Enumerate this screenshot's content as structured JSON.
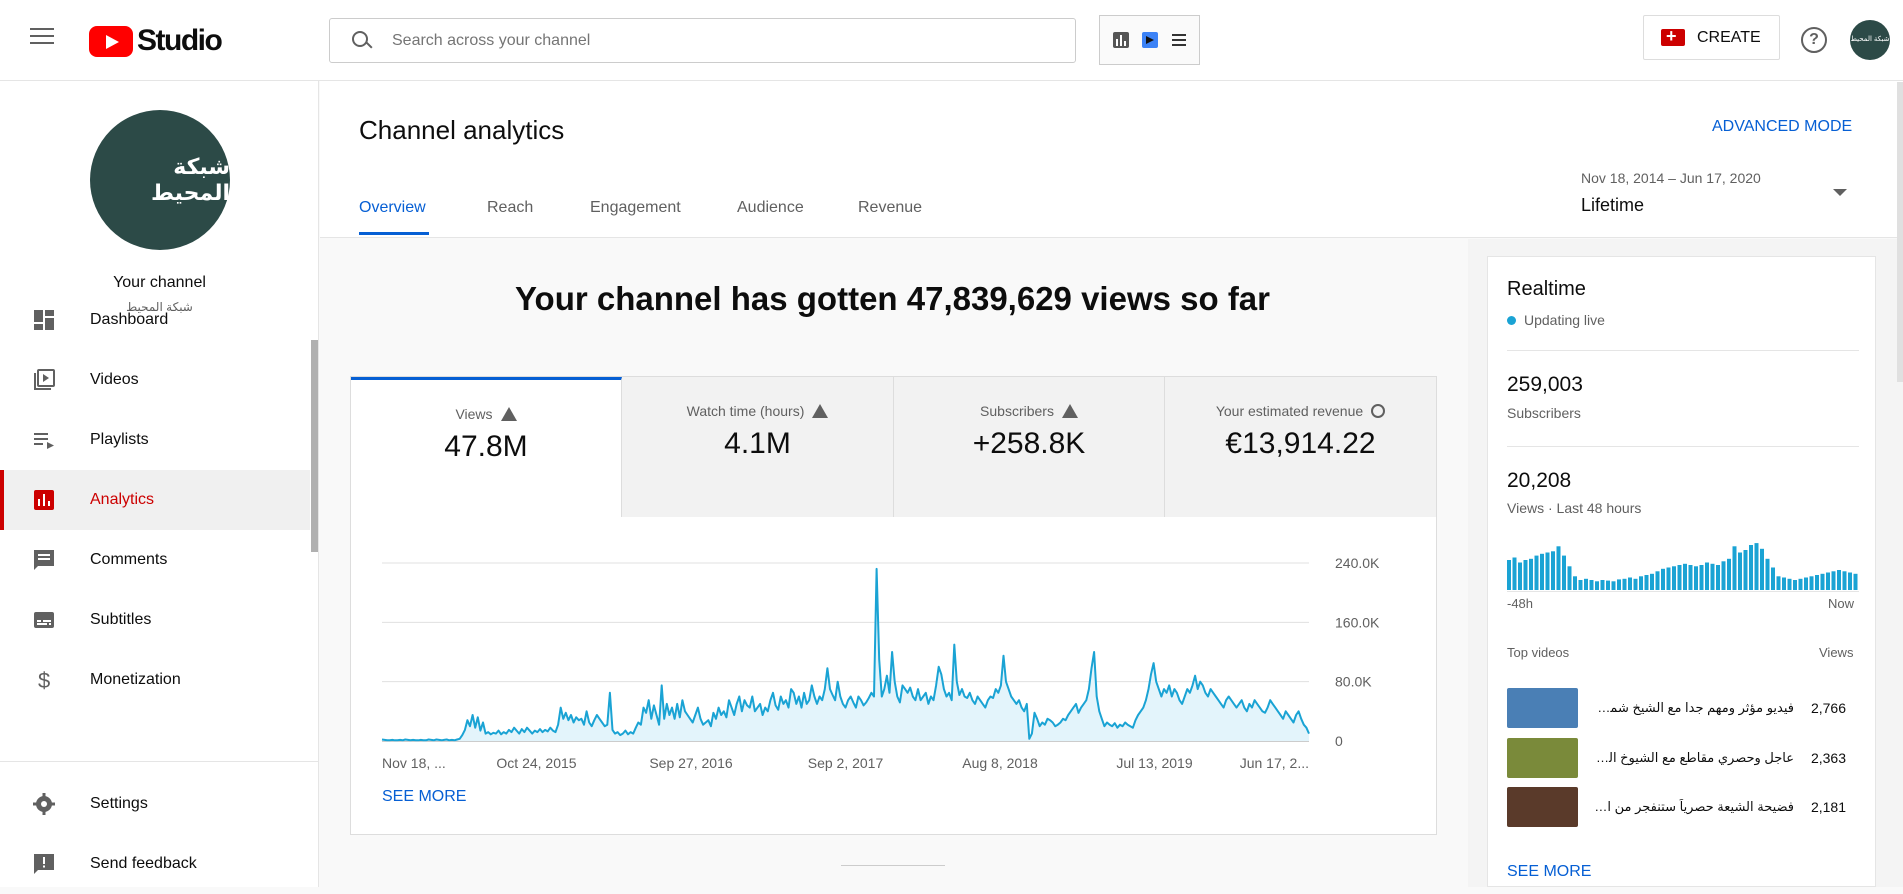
{
  "app": {
    "logo_text": "Studio",
    "create_label": "CREATE",
    "help_symbol": "?",
    "avatar_text": "شبكة المحيط"
  },
  "search": {
    "placeholder": "Search across your channel"
  },
  "sidebar": {
    "channel_avatar_text": "شبكة المحيط",
    "channel_title": "Your channel",
    "channel_name": "شبكة المحيط",
    "items": [
      {
        "label": "Dashboard",
        "icon": "dashboard-icon"
      },
      {
        "label": "Videos",
        "icon": "videos-icon"
      },
      {
        "label": "Playlists",
        "icon": "playlists-icon"
      },
      {
        "label": "Analytics",
        "icon": "analytics-icon",
        "active": true
      },
      {
        "label": "Comments",
        "icon": "comments-icon"
      },
      {
        "label": "Subtitles",
        "icon": "subtitles-icon"
      },
      {
        "label": "Monetization",
        "icon": "monetization-icon"
      },
      {
        "label": "Settings",
        "icon": "settings-icon"
      },
      {
        "label": "Send feedback",
        "icon": "feedback-icon"
      }
    ]
  },
  "header": {
    "title": "Channel analytics",
    "advanced_mode": "ADVANCED MODE",
    "tabs": [
      "Overview",
      "Reach",
      "Engagement",
      "Audience",
      "Revenue"
    ],
    "date_range": "Nov 18, 2014 – Jun 17, 2020",
    "date_label": "Lifetime"
  },
  "overview": {
    "headline": "Your channel has gotten 47,839,629 views so far",
    "metrics": [
      {
        "name": "Views",
        "value": "47.8M",
        "icon": "warning-icon"
      },
      {
        "name": "Watch time (hours)",
        "value": "4.1M",
        "icon": "warning-icon"
      },
      {
        "name": "Subscribers",
        "value": "+258.8K",
        "icon": "warning-icon"
      },
      {
        "name": "Your estimated revenue",
        "value": "€13,914.22",
        "icon": "clock-icon"
      }
    ],
    "see_more": "SEE MORE"
  },
  "chart_data": {
    "type": "area",
    "title": "",
    "xlabel": "",
    "ylabel": "",
    "x_tick_labels": [
      "Nov 18, ...",
      "Oct 24, 2015",
      "Sep 27, 2016",
      "Sep 2, 2017",
      "Aug 8, 2018",
      "Jul 13, 2019",
      "Jun 17, 2..."
    ],
    "y_tick_labels": [
      "240.0K",
      "160.0K",
      "80.0K",
      "0"
    ],
    "ylim": [
      0,
      240000
    ],
    "grid": true,
    "color": "#1aa3d4",
    "fill_color": "#e3f4fb",
    "series": [
      {
        "values": [
          2000,
          1500,
          1000,
          1000,
          1500,
          1000,
          1000,
          1500,
          1000,
          2000,
          1500,
          1000,
          1500,
          1000,
          1000,
          1500,
          1000,
          1000,
          2000,
          1500,
          1000,
          2000,
          1500,
          1000,
          1500,
          2000,
          1000,
          1500,
          1000,
          2000,
          3000,
          8000,
          15000,
          28000,
          20000,
          35000,
          18000,
          32000,
          14000,
          25000,
          10000,
          12000,
          9000,
          11000,
          10000,
          14000,
          9000,
          12000,
          10000,
          15000,
          12000,
          18000,
          14000,
          10000,
          16000,
          12000,
          18000,
          14000,
          10000,
          14000,
          12000,
          16000,
          12000,
          15000,
          13000,
          18000,
          14000,
          12000,
          22000,
          45000,
          30000,
          38000,
          28000,
          35000,
          25000,
          32000,
          28000,
          30000,
          22000,
          40000,
          25000,
          20000,
          28000,
          35000,
          30000,
          25000,
          20000,
          22000,
          65000,
          15000,
          10000,
          12000,
          8000,
          10000,
          14000,
          9000,
          12000,
          10000,
          18000,
          25000,
          22000,
          45000,
          38000,
          55000,
          30000,
          48000,
          35000,
          22000,
          75000,
          30000,
          50000,
          35000,
          45000,
          30000,
          50000,
          32000,
          55000,
          40000,
          35000,
          30000,
          25000,
          35000,
          45000,
          30000,
          22000,
          25000,
          28000,
          20000,
          38000,
          30000,
          45000,
          35000,
          40000,
          32000,
          55000,
          45000,
          35000,
          50000,
          60000,
          40000,
          55000,
          48000,
          45000,
          60000,
          40000,
          45000,
          50000,
          35000,
          45000,
          40000,
          55000,
          65000,
          48000,
          42000,
          60000,
          50000,
          55000,
          45000,
          70000,
          65000,
          50000,
          60000,
          45000,
          65000,
          50000,
          55000,
          75000,
          60000,
          50000,
          60000,
          55000,
          70000,
          98000,
          70000,
          62000,
          55000,
          80000,
          60000,
          50000,
          45000,
          55000,
          60000,
          52000,
          45000,
          60000,
          55000,
          48000,
          52000,
          58000,
          65000,
          60000,
          232000,
          110000,
          60000,
          70000,
          88000,
          65000,
          120000,
          80000,
          60000,
          52000,
          75000,
          70000,
          65000,
          72000,
          60000,
          55000,
          70000,
          55000,
          60000,
          65000,
          50000,
          60000,
          55000,
          75000,
          100000,
          90000,
          70000,
          60000,
          65000,
          55000,
          130000,
          80000,
          62000,
          70000,
          60000,
          58000,
          65000,
          55000,
          50000,
          60000,
          55000,
          50000,
          45000,
          55000,
          60000,
          58000,
          70000,
          65000,
          75000,
          115000,
          80000,
          70000,
          60000,
          55000,
          50000,
          55000,
          45000,
          40000,
          50000,
          3000,
          10000,
          38000,
          30000,
          20000,
          25000,
          22000,
          30000,
          28000,
          25000,
          20000,
          22000,
          25000,
          30000,
          28000,
          35000,
          40000,
          45000,
          50000,
          38000,
          45000,
          50000,
          55000,
          70000,
          98000,
          120000,
          60000,
          40000,
          30000,
          20000,
          25000,
          22000,
          20000,
          24000,
          18000,
          22000,
          20000,
          25000,
          22000,
          20000,
          18000,
          28000,
          35000,
          40000,
          45000,
          55000,
          70000,
          90000,
          105000,
          80000,
          70000,
          60000,
          70000,
          65000,
          75000,
          60000,
          70000,
          65000,
          55000,
          50000,
          60000,
          70000,
          65000,
          75000,
          88000,
          70000,
          80000,
          75000,
          65000,
          60000,
          70000,
          65000,
          60000,
          55000,
          50000,
          45000,
          55000,
          60000,
          55000,
          50000,
          45000,
          50000,
          55000,
          45000,
          40000,
          50000,
          45000,
          55000,
          50000,
          45000,
          40000,
          38000,
          45000,
          55000,
          50000,
          45000,
          40000,
          35000,
          30000,
          40000,
          35000,
          30000,
          25000,
          35000,
          40000,
          30000,
          22000,
          18000,
          10000
        ]
      }
    ]
  },
  "realtime": {
    "title": "Realtime",
    "live_text": "Updating live",
    "subscribers_value": "259,003",
    "subscribers_label": "Subscribers",
    "views_value": "20,208",
    "views_label": "Views · Last 48 hours",
    "axis_start": "-48h",
    "axis_end": "Now",
    "top_videos_label": "Top videos",
    "views_column": "Views",
    "bars": [
      48,
      52,
      44,
      48,
      50,
      55,
      58,
      60,
      62,
      70,
      55,
      38,
      22,
      16,
      18,
      16,
      14,
      16,
      15,
      14,
      17,
      18,
      20,
      18,
      22,
      24,
      26,
      30,
      34,
      36,
      38,
      40,
      42,
      40,
      38,
      40,
      44,
      42,
      40,
      46,
      50,
      70,
      60,
      64,
      72,
      75,
      66,
      50,
      36,
      22,
      20,
      18,
      16,
      18,
      20,
      22,
      24,
      26,
      28,
      30,
      32,
      30,
      28,
      26
    ],
    "bars_max": 80,
    "videos": [
      {
        "title": "فيديو مؤثر ومهم جدا مع الشيخ شمس الدين! شيء لا يصدق",
        "views": "2,766",
        "thumb": "#4a7fb5"
      },
      {
        "title": "عاجل وحصري مقاطع مع الشيوخ الحرب لم تشاهدها من قبل",
        "views": "2,363",
        "thumb": "#7a8a3a"
      },
      {
        "title": "فضيحة الشيعة حصرياً ستنفجر من الضحك",
        "views": "2,181",
        "thumb": "#5a3a2a"
      }
    ],
    "see_more": "SEE MORE"
  }
}
